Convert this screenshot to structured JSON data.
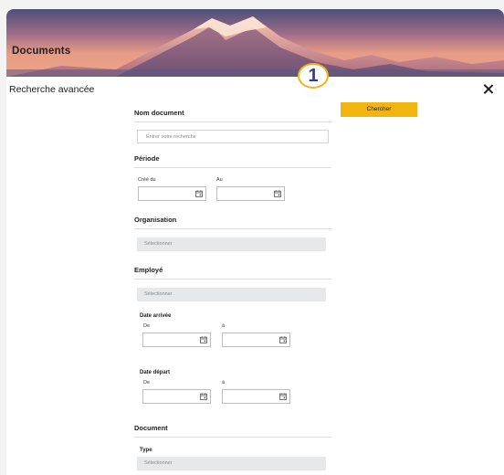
{
  "header": {
    "title": "Documents"
  },
  "modal": {
    "title": "Recherche avancée",
    "search_button": "Chercher"
  },
  "step_badge": "1",
  "sections": {
    "nom_document": {
      "title": "Nom document",
      "placeholder": "Entrer votre recherche"
    },
    "periode": {
      "title": "Période",
      "from_label": "Créé du",
      "to_label": "Au"
    },
    "organisation": {
      "title": "Organisation",
      "select_value": "Sélectionner"
    },
    "employe": {
      "title": "Employé",
      "select_value": "Sélectionner",
      "date_arrivee": {
        "title": "Date arrivée",
        "from_label": "De",
        "to_label": "à"
      },
      "date_depart": {
        "title": "Date départ",
        "from_label": "De",
        "to_label": "à"
      }
    },
    "document": {
      "title": "Document",
      "type_label": "Type",
      "type_value": "Sélectionner"
    }
  },
  "icons": {
    "calendar": "calendar-icon",
    "close": "close-icon"
  },
  "colors": {
    "accent": "#f2b50f",
    "badge_text": "#3b3f78",
    "select_bg": "#e6e8ea"
  }
}
